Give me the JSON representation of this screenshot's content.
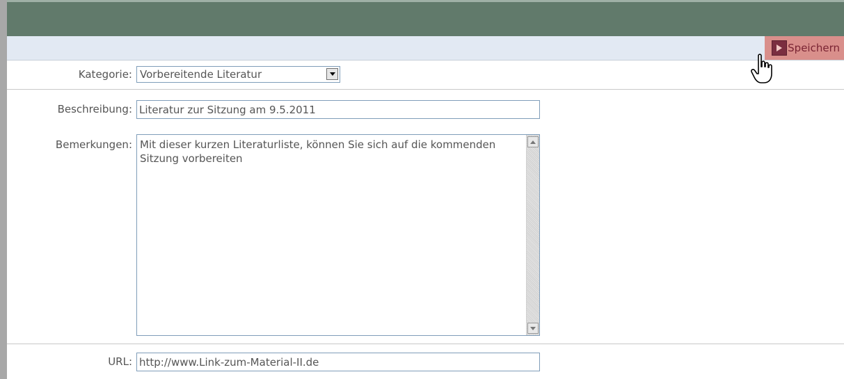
{
  "toolbar": {
    "save_label": "Speichern",
    "save_icon": "save-arrow-icon"
  },
  "form": {
    "kategorie": {
      "label": "Kategorie:",
      "value": "Vorbereitende Literatur"
    },
    "beschreibung": {
      "label": "Beschreibung:",
      "value": "Literatur zur Sitzung am 9.5.2011"
    },
    "bemerkungen": {
      "label": "Bemerkungen:",
      "value": "Mit dieser kurzen Literaturliste, können Sie sich auf die kommenden Sitzung vorbereiten"
    },
    "url": {
      "label": "URL:",
      "value": "http://www.Link-zum-Material-II.de"
    }
  },
  "colors": {
    "title_bar": "#617a6b",
    "toolbar_bg": "#e2e9f3",
    "save_button_bg": "#d98f8b",
    "save_icon_bg": "#7a2e40"
  }
}
